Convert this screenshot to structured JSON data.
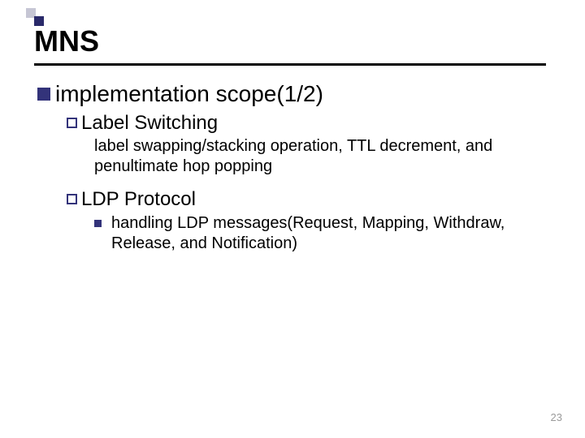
{
  "title": "MNS",
  "page_number": "23",
  "body": {
    "lvl1": {
      "text": "implementation scope(1/2)"
    },
    "sec1": {
      "heading": "Label Switching",
      "detail": "label swapping/stacking operation, TTL decrement, and penultimate hop popping"
    },
    "sec2": {
      "heading": "LDP Protocol",
      "detail": "handling LDP messages(Request, Mapping, Withdraw, Release, and Notification)"
    }
  }
}
